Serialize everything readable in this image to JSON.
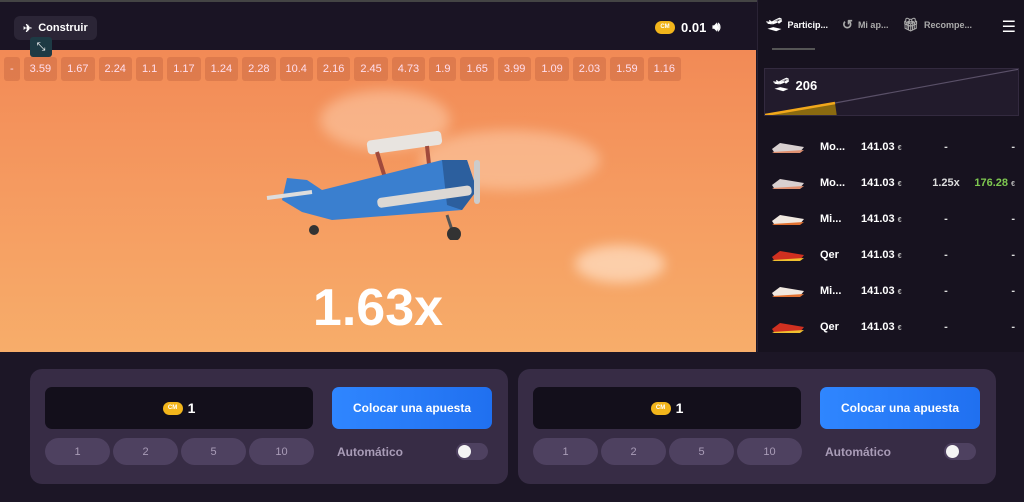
{
  "topbar": {
    "build_label": "Construir",
    "coin_label": "CM",
    "balance": "0.01"
  },
  "history": [
    "-",
    "3.59",
    "1.67",
    "2.24",
    "1.1",
    "1.17",
    "1.24",
    "2.28",
    "10.4",
    "2.16",
    "2.45",
    "4.73",
    "1.9",
    "1.65",
    "3.99",
    "1.09",
    "2.03",
    "1.59",
    "1.16"
  ],
  "game": {
    "multiplier": "1.63x"
  },
  "sidebar": {
    "tabs": [
      {
        "label": "Particip...",
        "icon": "plane-takeoff-icon"
      },
      {
        "label": "Mi ap...",
        "icon": "history-icon"
      },
      {
        "label": "Recompe...",
        "icon": "gift-icon"
      }
    ],
    "players_count": "206",
    "currency": "€",
    "rows": [
      {
        "name": "Mo...",
        "bet": "141.03",
        "mult": "-",
        "win": "-"
      },
      {
        "name": "Mo...",
        "bet": "141.03",
        "mult": "1.25x",
        "win": "176.28"
      },
      {
        "name": "Mi...",
        "bet": "141.03",
        "mult": "-",
        "win": "-"
      },
      {
        "name": "Qer",
        "bet": "141.03",
        "mult": "-",
        "win": "-"
      },
      {
        "name": "Mi...",
        "bet": "141.03",
        "mult": "-",
        "win": "-"
      },
      {
        "name": "Qer",
        "bet": "141.03",
        "mult": "-",
        "win": "-"
      }
    ]
  },
  "bets": [
    {
      "amount": "1",
      "button": "Colocar una apuesta",
      "quick": [
        "1",
        "2",
        "5",
        "10"
      ],
      "auto_label": "Automático",
      "auto_on": false
    },
    {
      "amount": "1",
      "button": "Colocar una apuesta",
      "quick": [
        "1",
        "2",
        "5",
        "10"
      ],
      "auto_label": "Automático",
      "auto_on": false
    }
  ],
  "colors": {
    "accent": "#2f86ff",
    "win": "#7ec850",
    "coin": "#f2b51b"
  }
}
